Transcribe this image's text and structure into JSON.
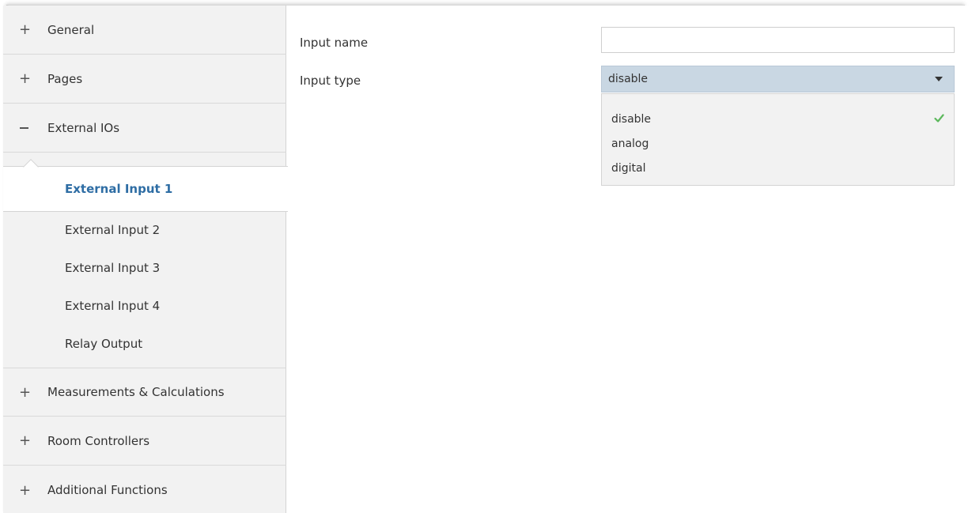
{
  "sidebar": {
    "groups": [
      {
        "label": "General",
        "toggle": "+"
      },
      {
        "label": "Pages",
        "toggle": "+"
      },
      {
        "label": "External IOs",
        "toggle": "−"
      },
      {
        "label": "Measurements & Calculations",
        "toggle": "+"
      },
      {
        "label": "Room Controllers",
        "toggle": "+"
      },
      {
        "label": "Additional Functions",
        "toggle": "+"
      }
    ],
    "subitems": [
      {
        "label": "External Input 1",
        "active": true
      },
      {
        "label": "External Input 2"
      },
      {
        "label": "External Input 3"
      },
      {
        "label": "External Input 4"
      },
      {
        "label": "Relay Output"
      }
    ]
  },
  "main": {
    "input_name": {
      "label": "Input name",
      "value": ""
    },
    "input_type": {
      "label": "Input type",
      "selected": "disable",
      "options": [
        "disable",
        "analog",
        "digital"
      ]
    }
  },
  "colors": {
    "active_text": "#2e6da4",
    "select_bg": "#c9d7e3",
    "check": "#5cb85c",
    "sidebar_bg": "#f2f2f2"
  }
}
